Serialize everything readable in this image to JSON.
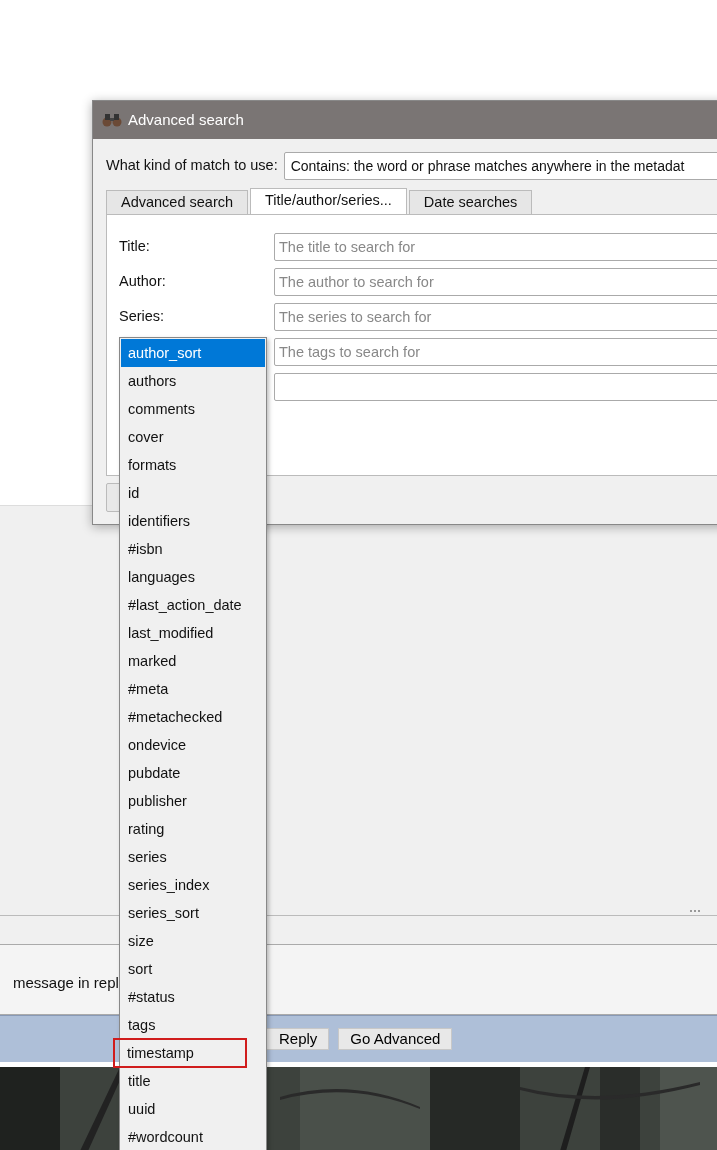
{
  "background": {
    "message_text": "message in repl",
    "buttons": [
      {
        "label": "Reply"
      },
      {
        "label": "Go Advanced"
      }
    ]
  },
  "dialog": {
    "title": "Advanced search",
    "match": {
      "label": "What kind of match to use:",
      "value": "Contains: the word or phrase matches anywhere in the metadat"
    },
    "tabs": [
      {
        "label": "Advanced search",
        "selected": false
      },
      {
        "label": "Title/author/series...",
        "selected": true
      },
      {
        "label": "Date searches",
        "selected": false
      }
    ],
    "fields": [
      {
        "kind": "text",
        "label": "Title:",
        "placeholder": "The title to search for"
      },
      {
        "kind": "text",
        "label": "Author:",
        "placeholder": "The author to search for"
      },
      {
        "kind": "text",
        "label": "Series:",
        "placeholder": "The series to search for"
      },
      {
        "kind": "text",
        "placeholder": "The tags to search for"
      },
      {
        "kind": "text"
      }
    ]
  },
  "dropdown": {
    "items": [
      {
        "label": "author_sort",
        "selected": true,
        "boxed": false
      },
      {
        "label": "authors",
        "selected": false,
        "boxed": false
      },
      {
        "label": "comments",
        "selected": false,
        "boxed": false
      },
      {
        "label": "cover",
        "selected": false,
        "boxed": false
      },
      {
        "label": "formats",
        "selected": false,
        "boxed": false
      },
      {
        "label": "id",
        "selected": false,
        "boxed": false
      },
      {
        "label": "identifiers",
        "selected": false,
        "boxed": false
      },
      {
        "label": "#isbn",
        "selected": false,
        "boxed": false
      },
      {
        "label": "languages",
        "selected": false,
        "boxed": false
      },
      {
        "label": "#last_action_date",
        "selected": false,
        "boxed": false
      },
      {
        "label": "last_modified",
        "selected": false,
        "boxed": false
      },
      {
        "label": "marked",
        "selected": false,
        "boxed": false
      },
      {
        "label": "#meta",
        "selected": false,
        "boxed": false
      },
      {
        "label": "#metachecked",
        "selected": false,
        "boxed": false
      },
      {
        "label": "ondevice",
        "selected": false,
        "boxed": false
      },
      {
        "label": "pubdate",
        "selected": false,
        "boxed": false
      },
      {
        "label": "publisher",
        "selected": false,
        "boxed": false
      },
      {
        "label": "rating",
        "selected": false,
        "boxed": false
      },
      {
        "label": "series",
        "selected": false,
        "boxed": false
      },
      {
        "label": "series_index",
        "selected": false,
        "boxed": false
      },
      {
        "label": "series_sort",
        "selected": false,
        "boxed": false
      },
      {
        "label": "size",
        "selected": false,
        "boxed": false
      },
      {
        "label": "sort",
        "selected": false,
        "boxed": false
      },
      {
        "label": "#status",
        "selected": false,
        "boxed": false
      },
      {
        "label": "tags",
        "selected": false,
        "boxed": false
      },
      {
        "label": "timestamp",
        "selected": false,
        "boxed": true
      },
      {
        "label": "title",
        "selected": false,
        "boxed": false
      },
      {
        "label": "uuid",
        "selected": false,
        "boxed": false
      },
      {
        "label": "#wordcount",
        "selected": false,
        "boxed": false
      }
    ]
  }
}
